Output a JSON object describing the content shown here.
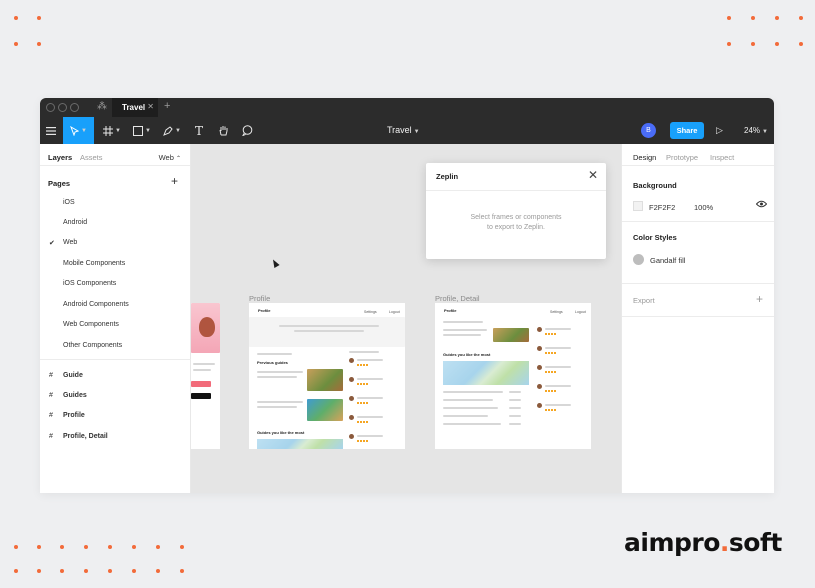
{
  "titlebar": {
    "tab_label": "Travel",
    "tab_close": "✕",
    "new_tab": "+"
  },
  "toolbar": {
    "menu_icon": "menu-icon",
    "document_title": "Travel",
    "avatar_initial": "B",
    "share_label": "Share",
    "zoom_level": "24%"
  },
  "left_panel": {
    "tabs": [
      "Layers",
      "Assets"
    ],
    "page_selector": "Web",
    "pages_heading": "Pages",
    "pages": [
      "iOS",
      "Android",
      "Web",
      "Mobile Components",
      "iOS Components",
      "Android Components",
      "Web Components",
      "Other Components"
    ],
    "frames": [
      "Guide",
      "Guides",
      "Profile",
      "Profile, Detail"
    ]
  },
  "right_panel": {
    "tabs": [
      "Design",
      "Prototype",
      "Inspect"
    ],
    "background_title": "Background",
    "background_hex": "F2F2F2",
    "background_opacity": "100%",
    "color_styles_title": "Color Styles",
    "color_style_name": "Gandalf fill",
    "export_title": "Export"
  },
  "canvas": {
    "frame_profile_label": "Profile",
    "frame_detail_label": "Profile, Detail",
    "mini": {
      "profile_header": "Profile",
      "nav_settings": "Settings",
      "nav_logout": "Logout",
      "previous_guides": "Previous guides",
      "guides_you_like": "Guides you like the most"
    }
  },
  "zeplin": {
    "title": "Zeplin",
    "line1": "Select frames or components",
    "line2": "to export to Zeplin."
  },
  "brand": {
    "part1": "aimpro",
    "dot": ".",
    "part2": "soft"
  },
  "colors": {
    "accent": "#18a0fb",
    "brand_dot": "#f26b3a",
    "toolbar": "#2c2c2c"
  }
}
